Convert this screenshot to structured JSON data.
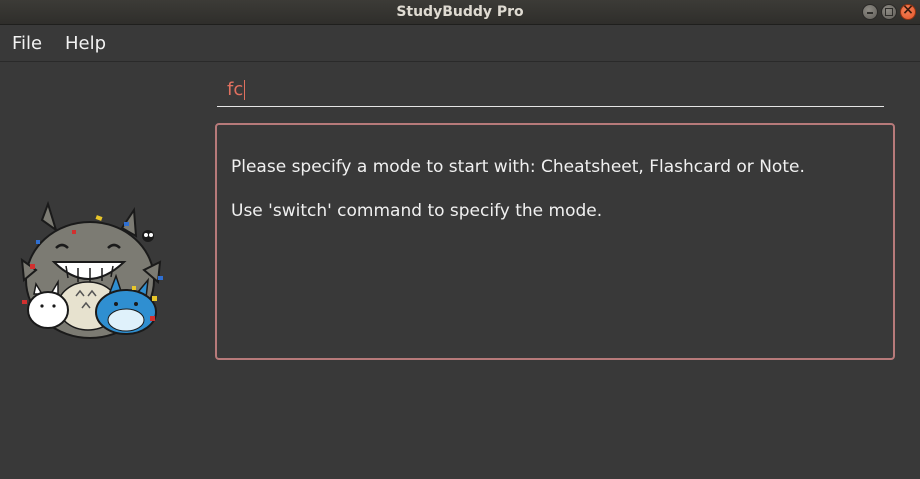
{
  "window": {
    "title": "StudyBuddy Pro"
  },
  "menu": {
    "file_label": "File",
    "help_label": "Help"
  },
  "command": {
    "value": "fc"
  },
  "result": {
    "line1": "Please specify a mode to start with: Cheatsheet, Flashcard or Note.",
    "line2": "Use 'switch' command to specify the mode."
  },
  "colors": {
    "accent_text": "#e0705f",
    "result_border": "#b77a7a",
    "background": "#393939"
  }
}
